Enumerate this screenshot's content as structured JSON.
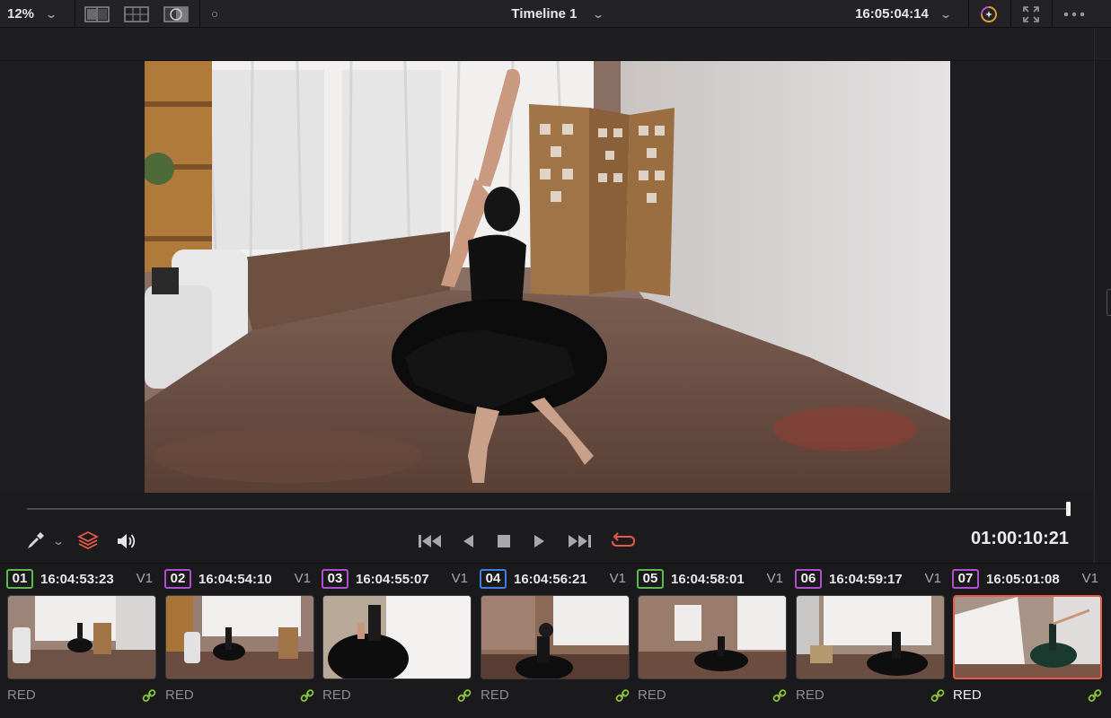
{
  "toolbar": {
    "zoom_level": "12%",
    "timeline_title": "Timeline 1",
    "source_timecode": "16:05:04:14"
  },
  "transport": {
    "timecode": "01:00:10:21"
  },
  "colors": {
    "accent_red": "#e85a48",
    "link_green": "#8cc43c"
  },
  "clips": [
    {
      "number": "01",
      "timecode": "16:04:53:23",
      "track": "V1",
      "codec": "RED",
      "badge_color": "#5fb84a"
    },
    {
      "number": "02",
      "timecode": "16:04:54:10",
      "track": "V1",
      "codec": "RED",
      "badge_color": "#b24fd0"
    },
    {
      "number": "03",
      "timecode": "16:04:55:07",
      "track": "V1",
      "codec": "RED",
      "badge_color": "#b24fd0"
    },
    {
      "number": "04",
      "timecode": "16:04:56:21",
      "track": "V1",
      "codec": "RED",
      "badge_color": "#3f7fe0"
    },
    {
      "number": "05",
      "timecode": "16:04:58:01",
      "track": "V1",
      "codec": "RED",
      "badge_color": "#5fb84a"
    },
    {
      "number": "06",
      "timecode": "16:04:59:17",
      "track": "V1",
      "codec": "RED",
      "badge_color": "#b24fd0"
    },
    {
      "number": "07",
      "timecode": "16:05:01:08",
      "track": "V1",
      "codec": "RED",
      "badge_color": "#b24fd0"
    }
  ]
}
